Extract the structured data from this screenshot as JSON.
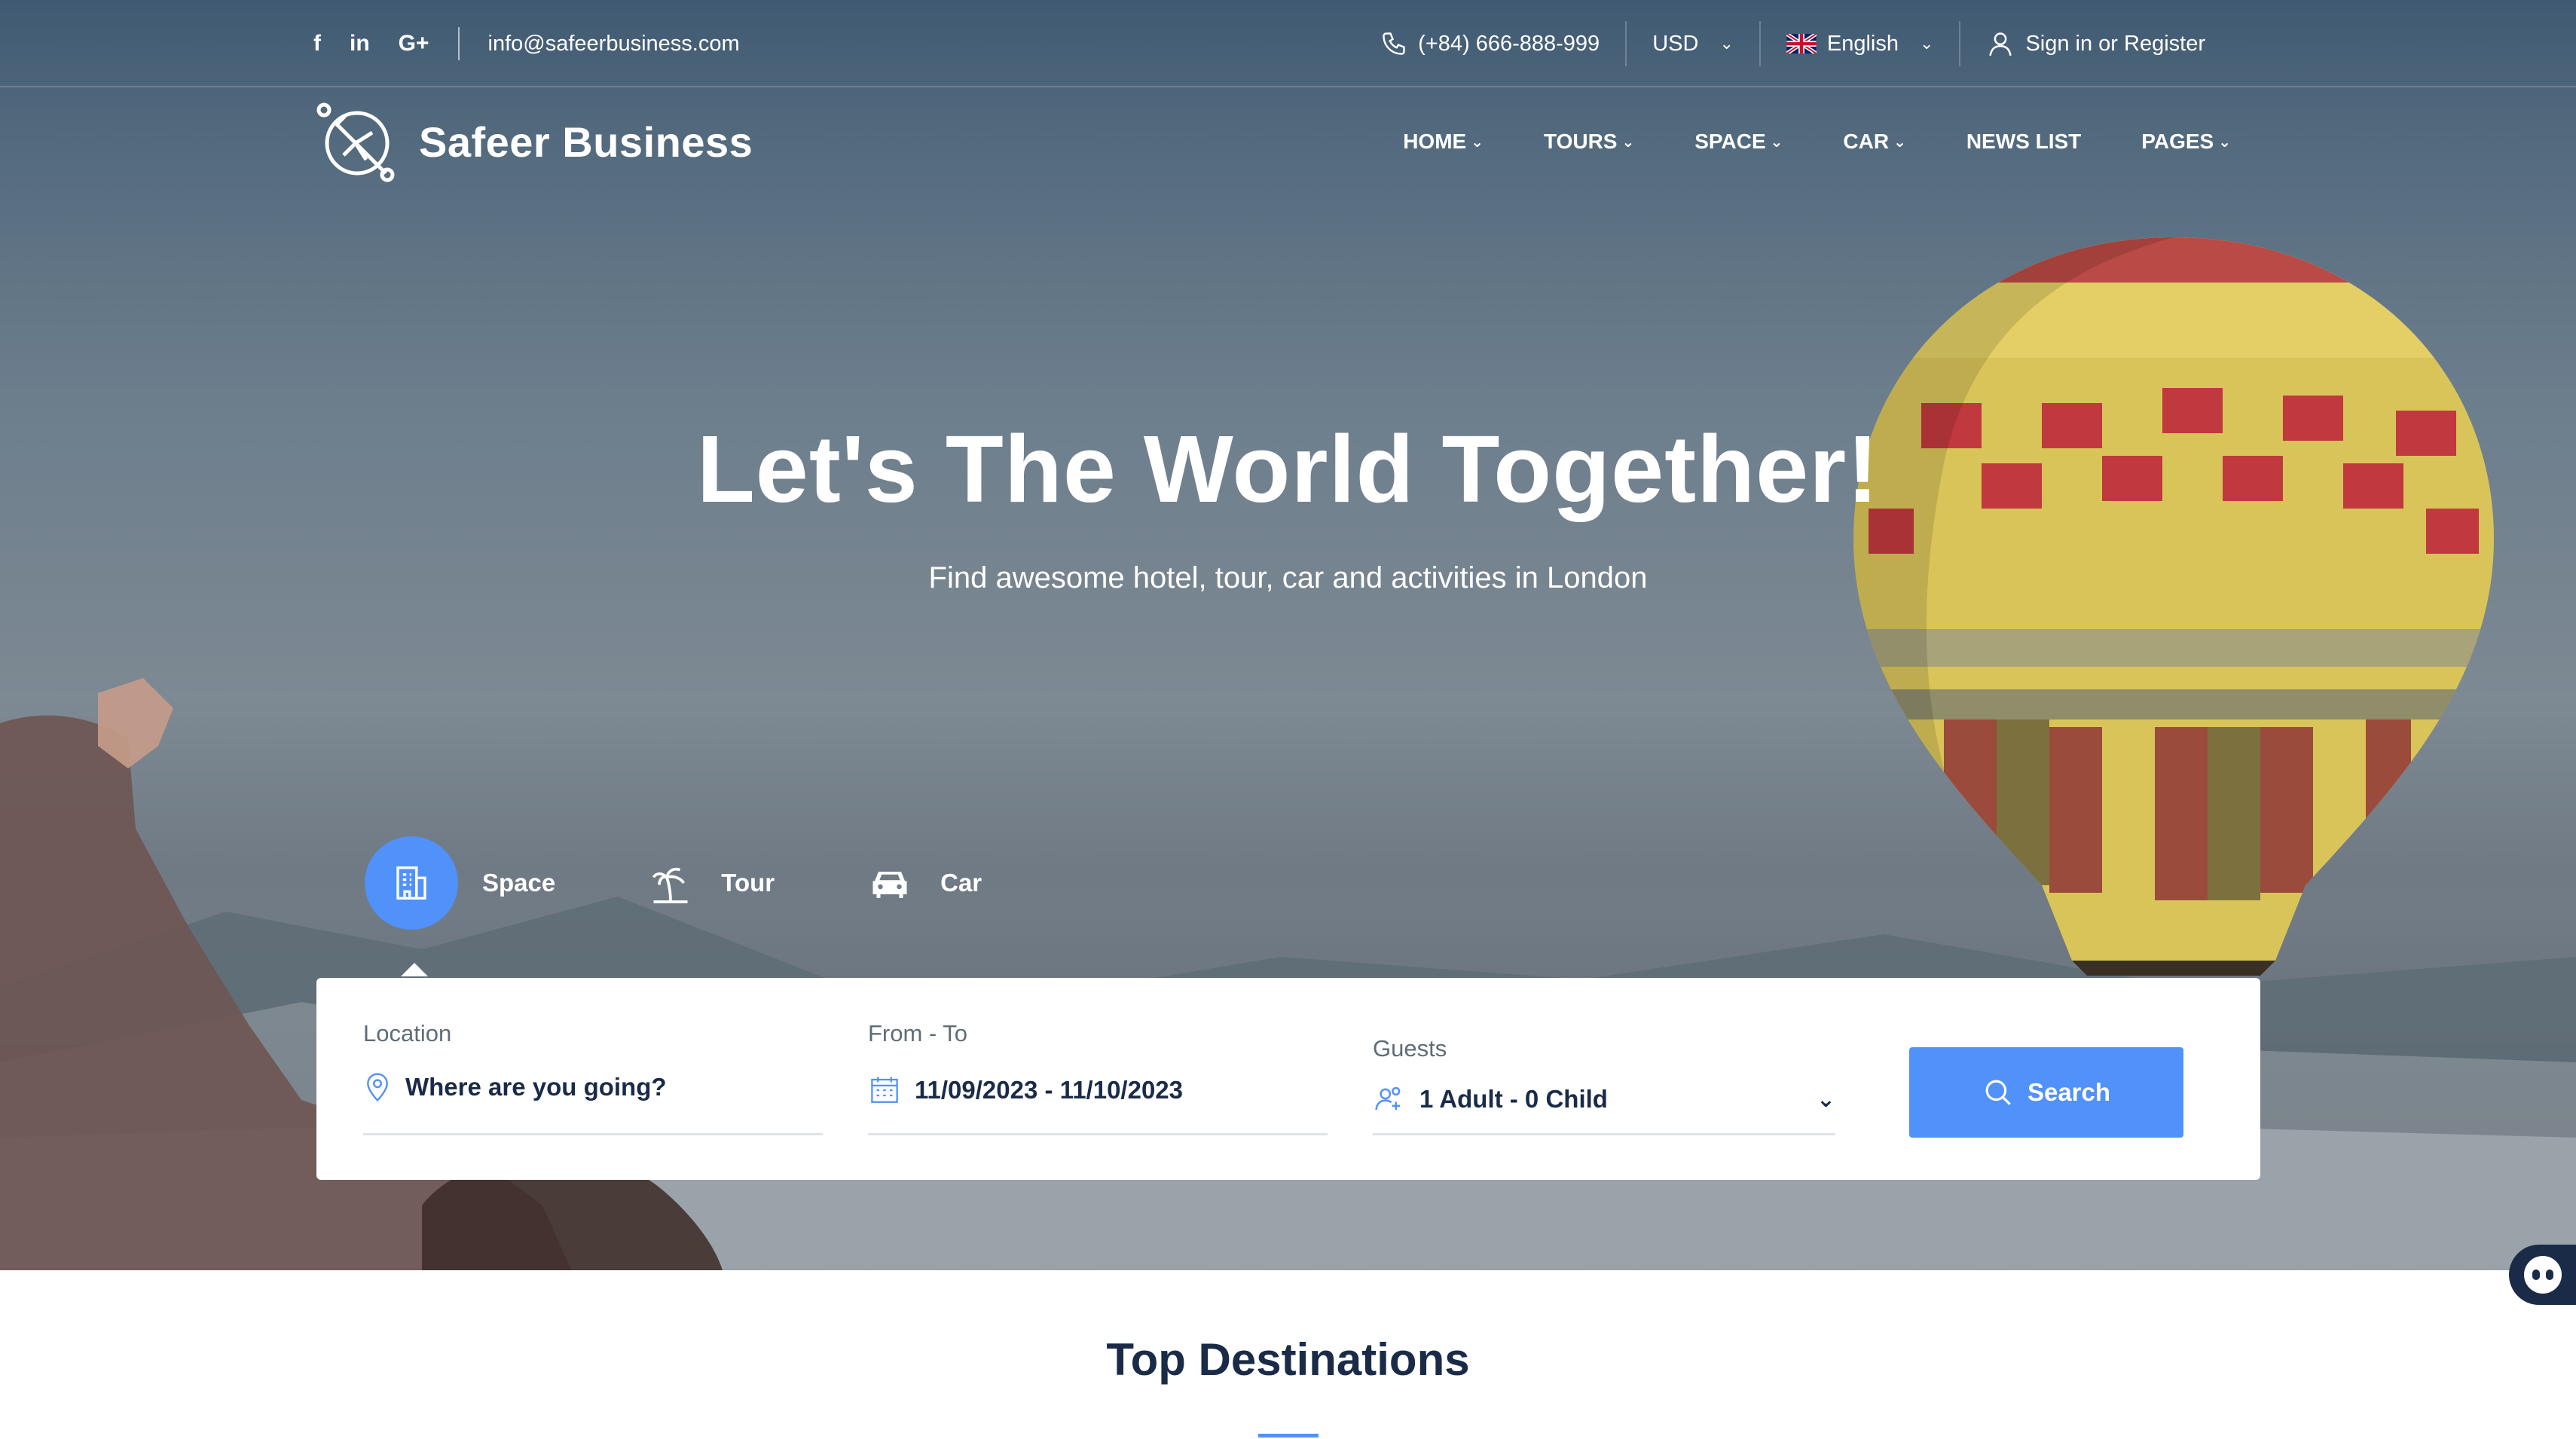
{
  "topbar": {
    "social": [
      "f",
      "in",
      "G+"
    ],
    "email": "info@safeerbusiness.com",
    "phone": "(+84) 666-888-999",
    "currency": "USD",
    "language": "English",
    "account": "Sign in or Register"
  },
  "brand": {
    "name": "Safeer Business"
  },
  "menu": [
    {
      "label": "HOME",
      "dropdown": true
    },
    {
      "label": "TOURS",
      "dropdown": true
    },
    {
      "label": "SPACE",
      "dropdown": true
    },
    {
      "label": "CAR",
      "dropdown": true
    },
    {
      "label": "NEWS LIST",
      "dropdown": false
    },
    {
      "label": "PAGES",
      "dropdown": true
    }
  ],
  "hero": {
    "title": "Let's The World Together!",
    "subtitle": "Find awesome hotel, tour, car and activities in London"
  },
  "tabs": [
    {
      "label": "Space",
      "icon": "building-icon",
      "active": true
    },
    {
      "label": "Tour",
      "icon": "palm-tree-icon",
      "active": false
    },
    {
      "label": "Car",
      "icon": "car-icon",
      "active": false
    }
  ],
  "search": {
    "location_label": "Location",
    "location_placeholder": "Where are you going?",
    "dates_label": "From - To",
    "dates_value": "11/09/2023 - 11/10/2023",
    "guests_label": "Guests",
    "guests_value": "1 Adult - 0 Child",
    "button": "Search"
  },
  "section": {
    "title": "Top Destinations"
  },
  "colors": {
    "accent": "#5191fa",
    "text_dark": "#1a2b48"
  }
}
